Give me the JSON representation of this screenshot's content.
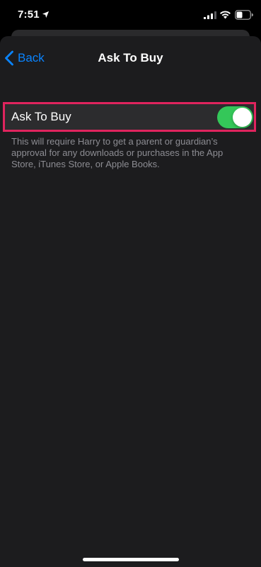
{
  "status_bar": {
    "time": "7:51",
    "location_icon": "location-arrow-icon",
    "signal_icon": "cellular-signal-icon",
    "wifi_icon": "wifi-icon",
    "battery_icon": "battery-icon"
  },
  "nav": {
    "back_label": "Back",
    "back_icon": "chevron-left-icon",
    "title": "Ask To Buy"
  },
  "setting": {
    "label": "Ask To Buy",
    "toggle_on": true,
    "footer": "This will require Harry to get a parent or guardian’s approval for any downloads or purchases in the App Store, iTunes Store, or Apple Books."
  },
  "colors": {
    "accent": "#0a84ff",
    "toggle_on": "#34c759",
    "highlight": "#e0245e",
    "background": "#1c1c1e"
  }
}
